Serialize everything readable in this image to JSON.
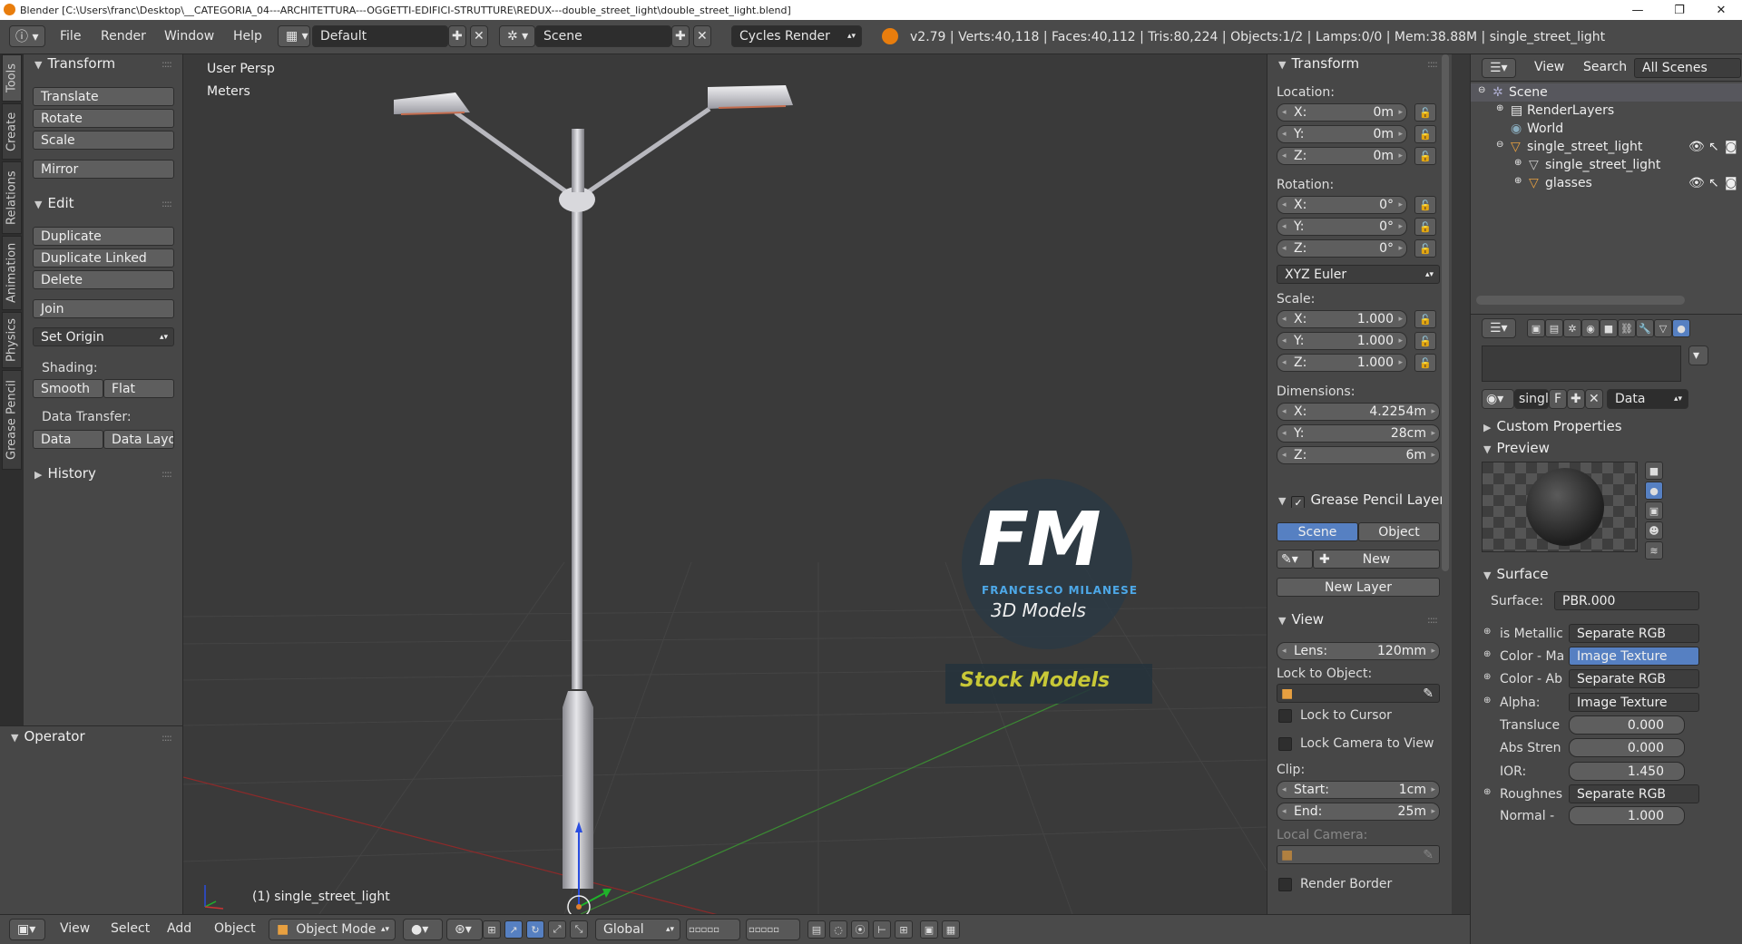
{
  "window": {
    "title": "Blender [C:\\Users\\franc\\Desktop\\__CATEGORIA_04---ARCHITETTURA---OGGETTI-EDIFICI-STRUTTURE\\REDUX---double_street_light\\double_street_light.blend]",
    "min": "—",
    "max": "❐",
    "close": "✕"
  },
  "topbar": {
    "menus": [
      "File",
      "Render",
      "Window",
      "Help"
    ],
    "layout": "Default",
    "scene": "Scene",
    "engine": "Cycles Render",
    "stats": "v2.79 | Verts:40,118 | Faces:40,112 | Tris:80,224 | Objects:1/2 | Lamps:0/0 | Mem:38.88M | single_street_light"
  },
  "tabs": [
    "Tools",
    "Create",
    "Relations",
    "Animation",
    "Physics",
    "Grease Pencil"
  ],
  "toolshelf": {
    "transform_header": "Transform",
    "transform": [
      "Translate",
      "Rotate",
      "Scale"
    ],
    "mirror": "Mirror",
    "edit_header": "Edit",
    "edit": [
      "Duplicate",
      "Duplicate Linked",
      "Delete"
    ],
    "join": "Join",
    "set_origin": "Set Origin",
    "shading_label": "Shading:",
    "smooth": "Smooth",
    "flat": "Flat",
    "data_transfer_label": "Data Transfer:",
    "data": "Data",
    "data_layo": "Data Layo",
    "history": "History",
    "operator": "Operator"
  },
  "viewport": {
    "view_name": "User Persp",
    "units": "Meters",
    "object_label": "(1) single_street_light",
    "logo_fm": "FM",
    "logo_name": "FRANCESCO MILANESE",
    "logo_sub": "3D Models",
    "stock": "Stock Models"
  },
  "npanel": {
    "transform": "Transform",
    "location": "Location:",
    "loc": [
      {
        "k": "X:",
        "v": "0m"
      },
      {
        "k": "Y:",
        "v": "0m"
      },
      {
        "k": "Z:",
        "v": "0m"
      }
    ],
    "rotation": "Rotation:",
    "rot": [
      {
        "k": "X:",
        "v": "0°"
      },
      {
        "k": "Y:",
        "v": "0°"
      },
      {
        "k": "Z:",
        "v": "0°"
      }
    ],
    "euler": "XYZ Euler",
    "scale": "Scale:",
    "scl": [
      {
        "k": "X:",
        "v": "1.000"
      },
      {
        "k": "Y:",
        "v": "1.000"
      },
      {
        "k": "Z:",
        "v": "1.000"
      }
    ],
    "dimensions": "Dimensions:",
    "dim": [
      {
        "k": "X:",
        "v": "4.2254m"
      },
      {
        "k": "Y:",
        "v": "28cm"
      },
      {
        "k": "Z:",
        "v": "6m"
      }
    ],
    "gp_layer": "Grease Pencil Layer",
    "gp_scene": "Scene",
    "gp_object": "Object",
    "gp_new": "New",
    "gp_new_layer": "New Layer",
    "view": "View",
    "lens_k": "Lens:",
    "lens_v": "120mm",
    "lock_obj": "Lock to Object:",
    "lock_cursor": "Lock to Cursor",
    "lock_camera": "Lock Camera to View",
    "clip": "Clip:",
    "clip_start_k": "Start:",
    "clip_start_v": "1cm",
    "clip_end_k": "End:",
    "clip_end_v": "25m",
    "local_camera": "Local Camera:",
    "render_border": "Render Border"
  },
  "outliner": {
    "view": "View",
    "search": "Search",
    "filter": "All Scenes",
    "items": [
      "Scene",
      "RenderLayers",
      "World",
      "single_street_light",
      "single_street_light",
      "glasses"
    ]
  },
  "properties": {
    "mat_name": "single",
    "mat_f": "F",
    "link": "Data",
    "custom_props": "Custom Properties",
    "preview": "Preview",
    "surface_header": "Surface",
    "surface_k": "Surface:",
    "surface_v": "PBR.000",
    "rows": [
      {
        "k": "is Metallic",
        "v": "Separate RGB"
      },
      {
        "k": "Color - Ma",
        "v": "Image Texture"
      },
      {
        "k": "Color - Ab",
        "v": "Separate RGB"
      },
      {
        "k": "Alpha:",
        "v": "Image Texture"
      }
    ],
    "translu_k": "Transluce",
    "translu_v": "0.000",
    "abs_k": "Abs Stren",
    "abs_v": "0.000",
    "ior_k": "IOR:",
    "ior_v": "1.450",
    "rough_k": "Roughnes",
    "rough_v": "Separate RGB",
    "normal_k": "Normal -",
    "normal_v": "1.000"
  },
  "bottombar": {
    "view": "View",
    "select": "Select",
    "add": "Add",
    "object": "Object",
    "mode": "Object Mode",
    "orientation": "Global"
  }
}
